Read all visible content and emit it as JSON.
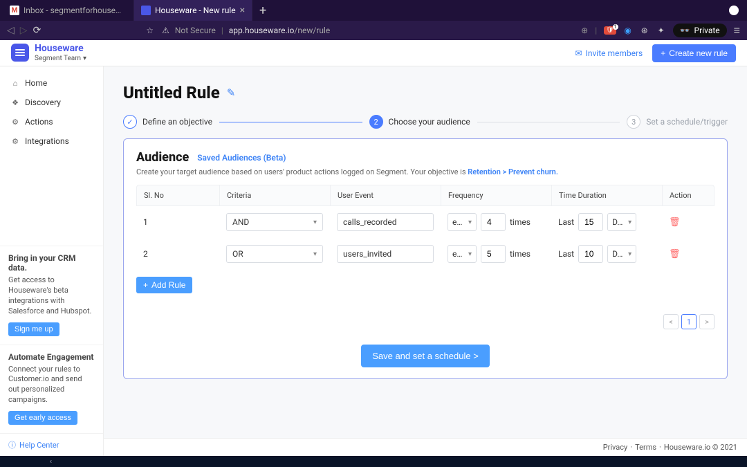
{
  "browser": {
    "tabs": [
      {
        "label": "Inbox - segmentforhouseware@gma",
        "favicon": "M"
      },
      {
        "label": "Houseware - New rule",
        "active": true
      }
    ],
    "newtab": "+",
    "nav_back": "◁",
    "nav_fwd": "▷",
    "reload": "⟳",
    "bookmark": "☆",
    "notsecure_icon": "⚠",
    "notsecure": "Not Secure",
    "url_host": "app.houseware.io",
    "url_path": "/new/rule",
    "shield_badge": "1",
    "private_label": "Private",
    "private_icon": "👓",
    "menu": "≡"
  },
  "header": {
    "brand": "Houseware",
    "team": "Segment Team",
    "team_chevron": "▾",
    "invite_icon": "✉",
    "invite": "Invite members",
    "create_icon": "+",
    "create": "Create new rule"
  },
  "sidebar": {
    "items": [
      {
        "icon": "⌂",
        "label": "Home"
      },
      {
        "icon": "❖",
        "label": "Discovery"
      },
      {
        "icon": "⚙",
        "label": "Actions"
      },
      {
        "icon": "⚙",
        "label": "Integrations"
      }
    ],
    "promo1": {
      "title": "Bring in your CRM data.",
      "body": "Get access to Houseware's beta integrations with Salesforce and Hubspot.",
      "cta": "Sign me up"
    },
    "promo2": {
      "title": "Automate Engagement",
      "body": "Connect your rules to Customer.io and send out personalized campaigns.",
      "cta": "Get early access"
    },
    "help_icon": "ⓘ",
    "help": "Help Center"
  },
  "page": {
    "title": "Untitled Rule",
    "edit_icon": "✎",
    "steps": [
      {
        "num": "✓",
        "label": "Define an objective"
      },
      {
        "num": "2",
        "label": "Choose your audience"
      },
      {
        "num": "3",
        "label": "Set a schedule/trigger"
      }
    ],
    "card": {
      "title": "Audience",
      "saved": "Saved Audiences (Beta)",
      "sub_pre": "Create your target audience based on users' product actions logged on Segment. Your objective is ",
      "objective": "Retention > Prevent churn."
    },
    "table": {
      "headers": [
        "Sl. No",
        "Criteria",
        "User Event",
        "Frequency",
        "Time Duration",
        "Action"
      ],
      "rows": [
        {
          "sl": "1",
          "criteria": "AND",
          "event": "calls_recorded",
          "cmp": "e…",
          "count": "4",
          "times": "times",
          "last": "Last",
          "dur": "15",
          "unit": "D…"
        },
        {
          "sl": "2",
          "criteria": "OR",
          "event": "users_invited",
          "cmp": "e…",
          "count": "5",
          "times": "times",
          "last": "Last",
          "dur": "10",
          "unit": "D…"
        }
      ],
      "add_rule": "Add Rule",
      "add_icon": "+"
    },
    "pager": {
      "prev": "<",
      "page": "1",
      "next": ">"
    },
    "save": "Save and set a schedule >"
  },
  "footer": {
    "privacy": "Privacy",
    "terms": "Terms",
    "copyright": "Houseware.io © 2021",
    "sep": " · "
  },
  "taskbar": {
    "arrow": "‹"
  }
}
